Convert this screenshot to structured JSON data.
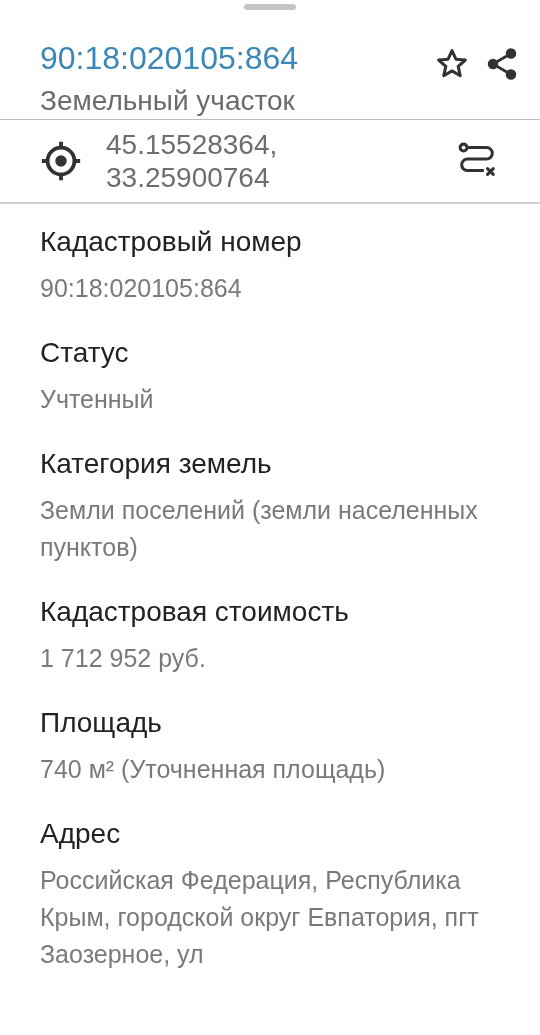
{
  "header": {
    "title": "90:18:020105:864",
    "subtitle": "Земельный участок"
  },
  "location": {
    "coordinates": "45.15528364,\n33.25900764"
  },
  "fields": [
    {
      "label": "Кадастровый номер",
      "value": "90:18:020105:864"
    },
    {
      "label": "Статус",
      "value": "Учтенный"
    },
    {
      "label": "Категория земель",
      "value": "Земли поселений (земли населенных пунктов)"
    },
    {
      "label": "Кадастровая стоимость",
      "value": "1 712 952 руб."
    },
    {
      "label": "Площадь",
      "value": "740 м² (Уточненная площадь)"
    },
    {
      "label": "Адрес",
      "value": "Российская Федерация, Республика Крым, городской округ Евпатория, пгт Заозерное, ул"
    }
  ]
}
